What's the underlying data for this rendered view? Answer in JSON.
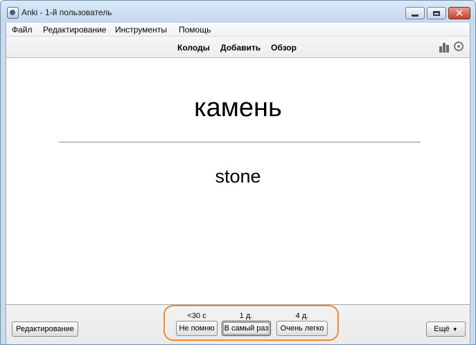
{
  "window": {
    "title": "Anki - 1-й пользователь"
  },
  "menubar": {
    "items": [
      "Файл",
      "Редактирование",
      "Инструменты",
      "Помощь"
    ]
  },
  "toolbar": {
    "links": [
      "Колоды",
      "Добавить",
      "Обзор"
    ],
    "right_icons": [
      "stats-icon",
      "sync-icon"
    ]
  },
  "card": {
    "front": "камень",
    "back": "stone"
  },
  "bottombar": {
    "edit_label": "Редактирование",
    "more_label": "Ещё",
    "answers": [
      {
        "interval": "<30 с",
        "label": "Не помню"
      },
      {
        "interval": "1 д.",
        "label": "В самый раз"
      },
      {
        "interval": "4 д.",
        "label": "Очень легко"
      }
    ]
  },
  "colors": {
    "highlight": "#f08a2c",
    "titlebar": "#c8dcf0"
  }
}
